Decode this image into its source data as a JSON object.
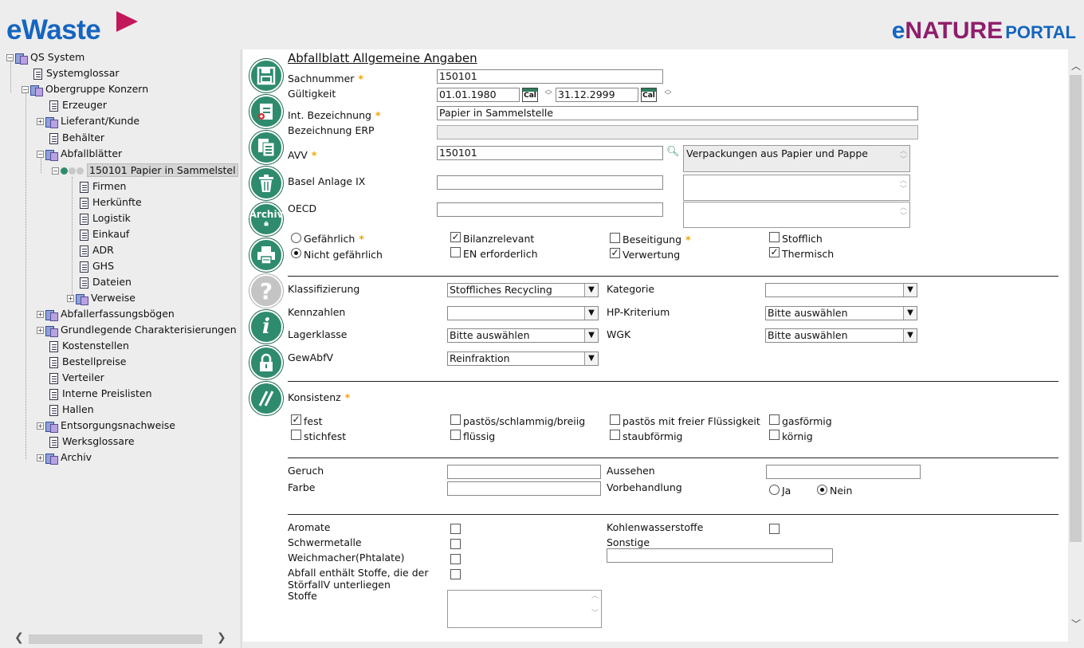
{
  "header": {
    "logo_left": "eWaste",
    "logo_right_e": "e",
    "logo_right_nature": "NATURE",
    "logo_right_portal": "PORTAL"
  },
  "tree": {
    "items": [
      {
        "label": "QS System"
      },
      {
        "label": "Systemglossar"
      },
      {
        "label": "Obergruppe Konzern"
      },
      {
        "label": "Erzeuger"
      },
      {
        "label": "Lieferant/Kunde"
      },
      {
        "label": "Behälter"
      },
      {
        "label": "Abfallblätter"
      },
      {
        "label": "150101 Papier in Sammelstel"
      },
      {
        "label": "Firmen"
      },
      {
        "label": "Herkünfte"
      },
      {
        "label": "Logistik"
      },
      {
        "label": "Einkauf"
      },
      {
        "label": "ADR"
      },
      {
        "label": "GHS"
      },
      {
        "label": "Dateien"
      },
      {
        "label": "Verweise"
      },
      {
        "label": "Abfallerfassungsbögen"
      },
      {
        "label": "Grundlegende Charakterisierungen"
      },
      {
        "label": "Kostenstellen"
      },
      {
        "label": "Bestellpreise"
      },
      {
        "label": "Verteiler"
      },
      {
        "label": "Interne Preislisten"
      },
      {
        "label": "Hallen"
      },
      {
        "label": "Entsorgungsnachweise"
      },
      {
        "label": "Werksglossare"
      },
      {
        "label": "Archiv"
      }
    ]
  },
  "toolbar": {
    "archiv_label": "Archiv"
  },
  "form": {
    "title": "Abfallblatt Allgemeine Angaben",
    "sachnummer_label": "Sachnummer",
    "sachnummer_value": "150101",
    "gueltigkeit_label": "Gültigkeit",
    "gueltig_von": "01.01.1980",
    "gueltig_bis": "31.12.2999",
    "cal_label": "Cal",
    "int_bez_label": "Int. Bezeichnung",
    "int_bez_value": "Papier in Sammelstelle",
    "bez_erp_label": "Bezeichnung ERP",
    "bez_erp_value": "",
    "avv_label": "AVV",
    "avv_value": "150101",
    "avv_desc": "Verpackungen aus Papier und Pappe",
    "basel_label": "Basel Anlage IX",
    "basel_value": "",
    "oecd_label": "OECD",
    "oecd_value": "",
    "gefaehrlich": "Gefährlich",
    "nicht_gefaehrlich": "Nicht gefährlich",
    "bilanzrelevant": "Bilanzrelevant",
    "en_erforderlich": "EN erforderlich",
    "beseitigung": "Beseitigung",
    "verwertung": "Verwertung",
    "stofflich": "Stofflich",
    "thermisch": "Thermisch",
    "klassifizierung_label": "Klassifizierung",
    "klassifizierung_value": "Stoffliches Recycling",
    "kategorie_label": "Kategorie",
    "kategorie_value": "",
    "kennzahlen_label": "Kennzahlen",
    "kennzahlen_value": "",
    "hp_label": "HP-Kriterium",
    "hp_value": "Bitte auswählen",
    "lagerklasse_label": "Lagerklasse",
    "lagerklasse_value": "Bitte auswählen",
    "wgk_label": "WGK",
    "wgk_value": "Bitte auswählen",
    "gewabfv_label": "GewAbfV",
    "gewabfv_value": "Reinfraktion",
    "konsistenz_label": "Konsistenz",
    "k_fest": "fest",
    "k_pastoes": "pastös/schlammig/breiig",
    "k_pastoes_fl": "pastös mit freier Flüssigkeit",
    "k_gas": "gasförmig",
    "k_stichfest": "stichfest",
    "k_fluessig": "flüssig",
    "k_staub": "staubförmig",
    "k_koernig": "körnig",
    "geruch_label": "Geruch",
    "geruch_value": "",
    "aussehen_label": "Aussehen",
    "aussehen_value": "",
    "farbe_label": "Farbe",
    "farbe_value": "",
    "vorbehandlung_label": "Vorbehandlung",
    "ja": "Ja",
    "nein": "Nein",
    "aromate": "Aromate",
    "kohlenwasserstoffe": "Kohlenwasserstoffe",
    "schwermetalle": "Schwermetalle",
    "sonstige": "Sonstige",
    "sonstige_value": "",
    "weichmacher": "Weichmacher(Phtalate)",
    "stoerfall_1": "Abfall enthält Stoffe, die der",
    "stoerfall_2": "StörfallV unterliegen",
    "stoffe": "Stoffe",
    "stoffe_value": ""
  },
  "state": {
    "gefaehrlich": false,
    "nicht_gefaehrlich": true,
    "bilanzrelevant": true,
    "en_erforderlich": false,
    "beseitigung": false,
    "verwertung": true,
    "stofflich": false,
    "thermisch": true,
    "fest": true,
    "vorbehandlung": "Nein"
  },
  "colors": {
    "accent_green": "#2e8b6e",
    "brand_blue": "#1565c0",
    "brand_magenta": "#8e1e6b",
    "required": "#f0a400"
  }
}
